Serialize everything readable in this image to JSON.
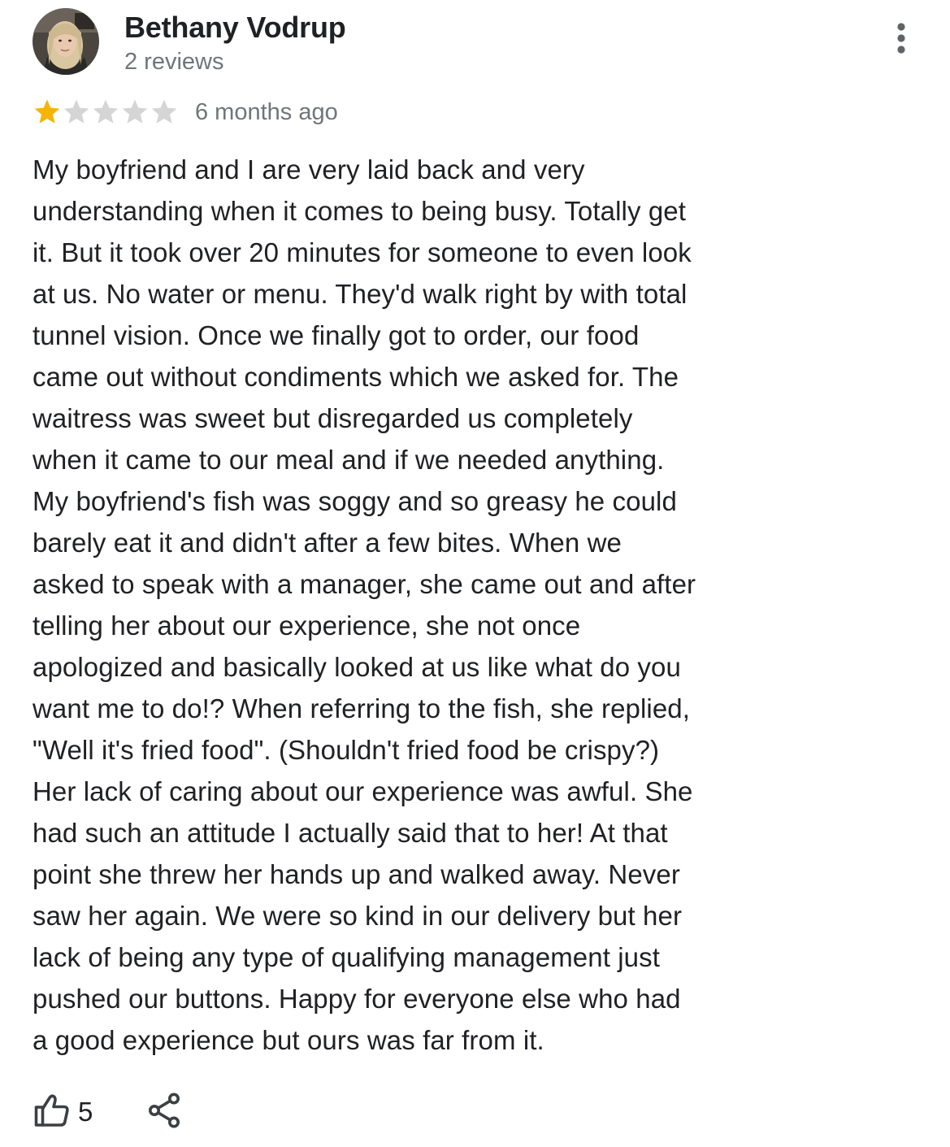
{
  "review": {
    "author_name": "Bethany Vodrup",
    "author_reviews": "2 reviews",
    "rating": 1,
    "rating_max": 5,
    "date": "6 months ago",
    "text_lines": [
      "My boyfriend and I are very laid back and very",
      "understanding when it comes to being busy. Totally get",
      "it. But it took over 20 minutes for someone to even look",
      "at us. No water or menu. They'd walk right by with total",
      "tunnel vision. Once we finally got to order, our food",
      "came out without condiments which we asked for. The",
      "waitress was sweet but disregarded us completely",
      "when it came to our meal and if we needed anything.",
      "My boyfriend's fish was soggy and so greasy he could",
      "barely eat it and didn't after a few bites. When we",
      "asked to speak with a manager, she came out and after",
      "telling her about our experience, she not once",
      "apologized and basically looked at us like what do you",
      "want me to do!? When referring to the fish, she replied,",
      "\"Well it's fried food\". (Shouldn't fried food be crispy?)",
      "Her lack of caring about our experience was awful. She",
      "had such an attitude I actually said that to her! At that",
      "point she threw her hands up and walked away. Never",
      "saw her again. We were so kind in our delivery but her",
      "lack of being any type of qualifying management just",
      "pushed our buttons. Happy for everyone else who had",
      "a good experience but ours was far from it."
    ],
    "like_count": "5"
  },
  "icons": {
    "avatar": "avatar-photo",
    "more": "more-vert-icon",
    "star_filled": "star-filled-icon",
    "star_empty": "star-empty-icon",
    "like": "thumb-up-icon",
    "share": "share-icon"
  },
  "colors": {
    "star_filled": "#f4b400",
    "star_empty": "#d5d5d5",
    "primary_text": "#202124",
    "secondary_text": "#70757a",
    "icon": "#3c4043",
    "more_icon": "#5f6368"
  }
}
